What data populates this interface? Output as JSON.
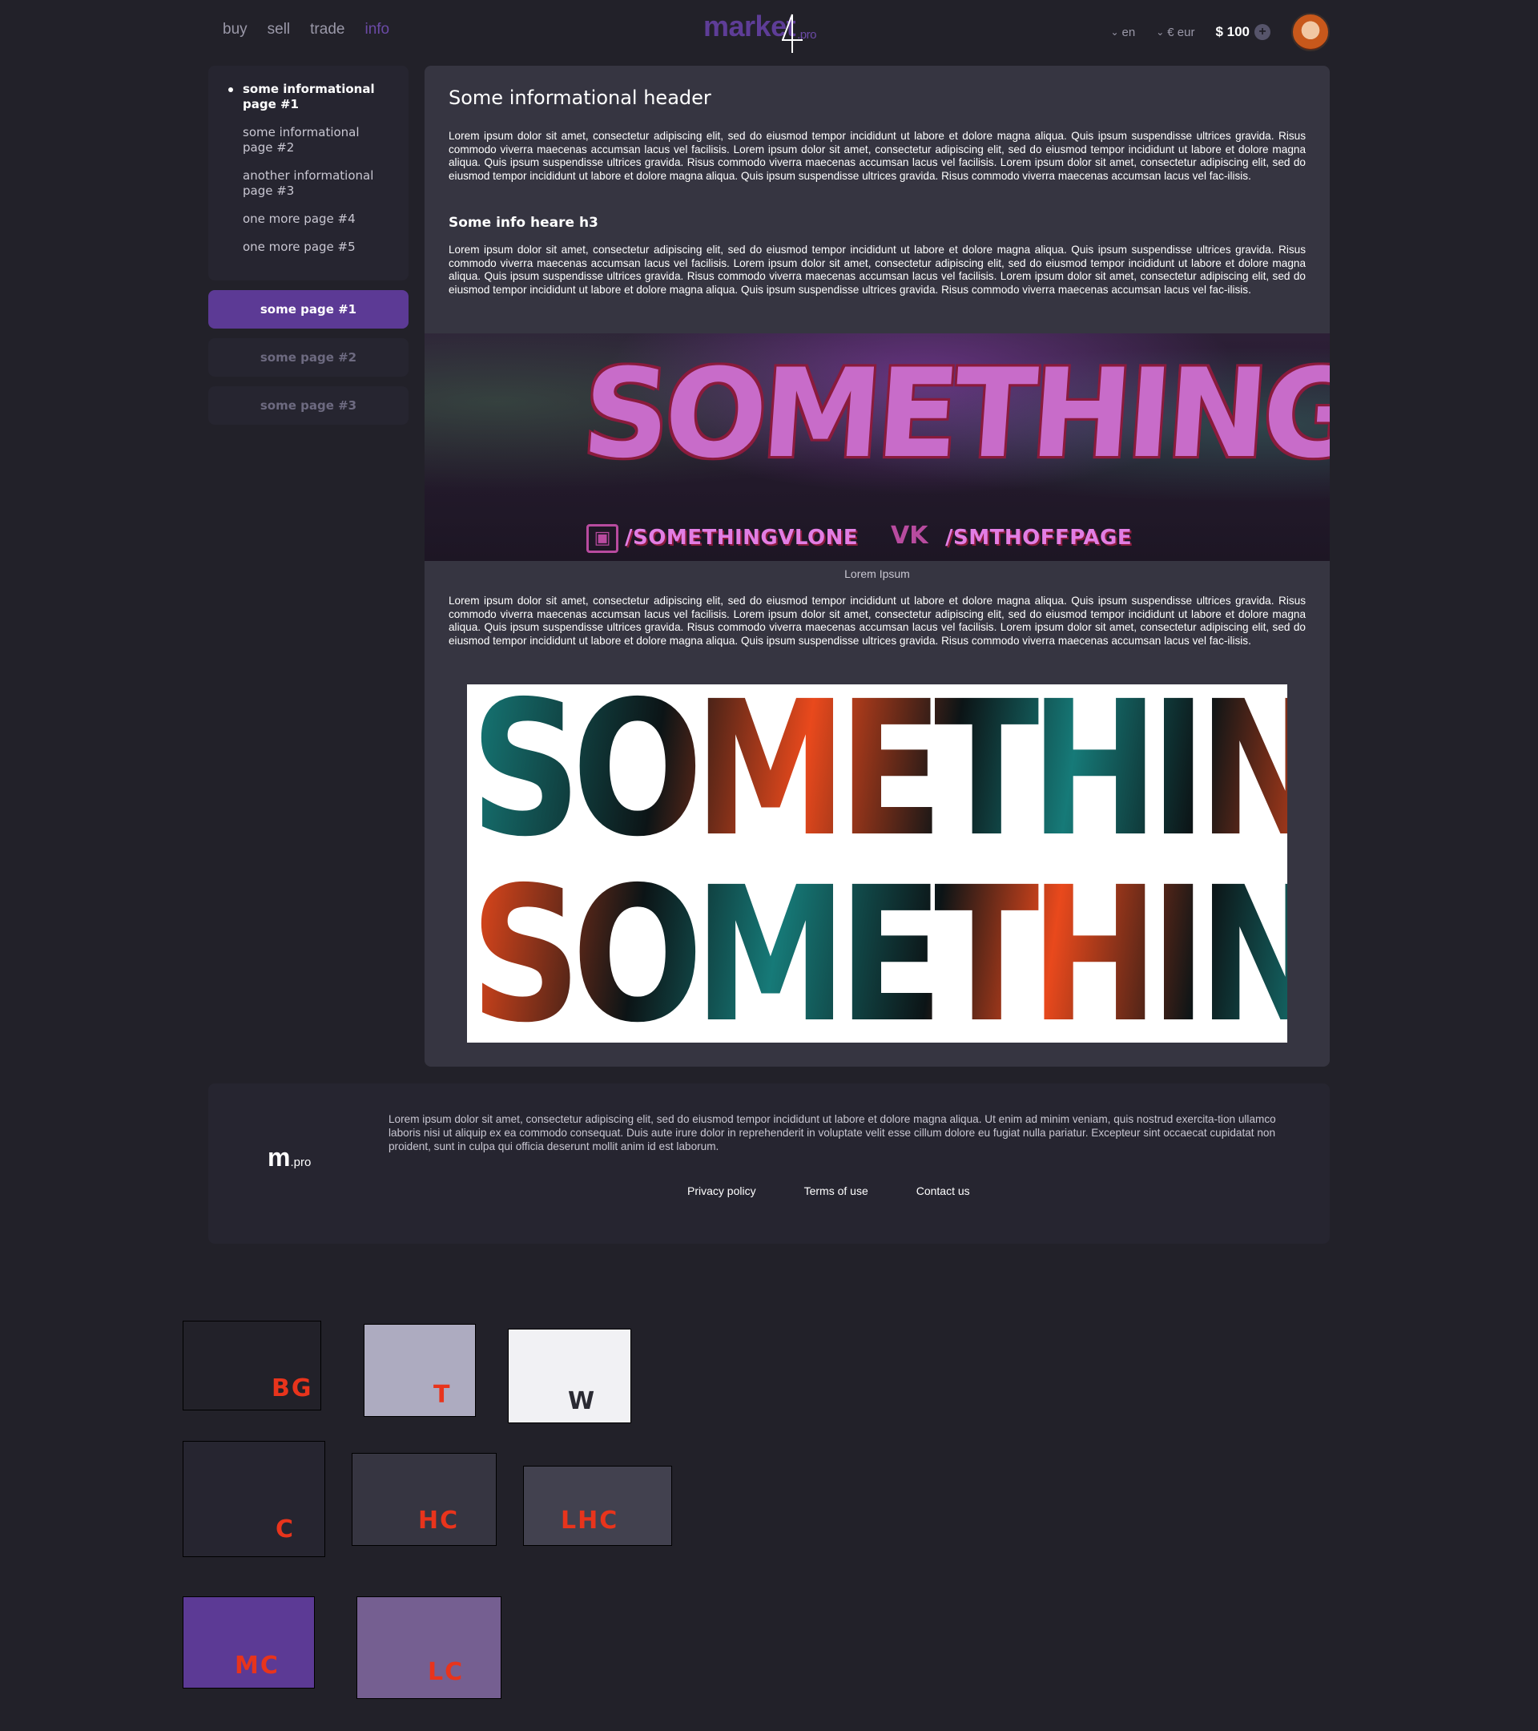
{
  "nav": {
    "items": [
      "buy",
      "sell",
      "trade",
      "info"
    ],
    "active": "info"
  },
  "logo": {
    "text": "market",
    "suffix": ".pro"
  },
  "header": {
    "lang": "en",
    "currency": "€ eur",
    "balance": "$ 100"
  },
  "sidebar": {
    "pages": [
      "some informational page #1",
      "some informational page #2",
      "another  informational page #3",
      "one more page #4",
      "one more page #5"
    ],
    "buttons": [
      "some page #1",
      "some page #2",
      "some page #3"
    ]
  },
  "main": {
    "title": "Some informational header",
    "subtitle": "Some info heare h3",
    "paragraph": "Lorem ipsum dolor sit amet, consectetur adipiscing elit, sed do eiusmod tempor incididunt ut labore et dolore magna aliqua. Quis ipsum suspendisse ultrices gravida. Risus commodo viverra maecenas accumsan lacus vel facilisis. Lorem ipsum dolor sit amet, consectetur adipiscing elit, sed do eiusmod tempor incididunt ut labore et dolore magna aliqua. Quis ipsum suspendisse ultrices gravida. Risus commodo viverra maecenas accumsan lacus vel facilisis. Lorem ipsum dolor sit amet, consectetur adipiscing elit, sed do eiusmod tempor incididunt ut labore et dolore magna aliqua. Quis ipsum suspendisse ultrices gravida. Risus commodo viverra maecenas accumsan lacus vel fac-ilisis.",
    "banner": {
      "title": "SOMETHING",
      "twitch": "/SOMETHINGVLONE",
      "vk": "/SMTHOFFPAGE"
    },
    "caption": "Lorem Ipsum",
    "image2": {
      "line1": "SOMETHING",
      "line2": "SOMETHING"
    }
  },
  "footer": {
    "logo": "m",
    "logo_suffix": ".pro",
    "text": "Lorem ipsum dolor sit amet, consectetur adipiscing elit, sed do eiusmod tempor incididunt ut labore et dolore magna aliqua. Ut enim ad minim veniam, quis nostrud exercita-tion ullamco laboris nisi ut aliquip ex ea commodo consequat. Duis aute irure dolor in reprehenderit in voluptate velit esse cillum dolore eu fugiat nulla pariatur. Excepteur sint occaecat cupidatat non proident, sunt in culpa qui officia deserunt mollit anim id est laborum.",
    "links": [
      "Privacy policy",
      "Terms of use",
      "Contact us"
    ]
  },
  "palette": [
    {
      "label": "BG",
      "color": "#222129",
      "ink": "#e8341c"
    },
    {
      "label": "T",
      "color": "#adabc0",
      "ink": "#e8341c"
    },
    {
      "label": "W",
      "color": "#f1f1f4",
      "ink": "#2a2a33"
    },
    {
      "label": "C",
      "color": "#262530",
      "ink": "#e8341c"
    },
    {
      "label": "HC",
      "color": "#363541",
      "ink": "#e8341c"
    },
    {
      "label": "LHC",
      "color": "#42414f",
      "ink": "#e8341c"
    },
    {
      "label": "MC",
      "color": "#5c3a95",
      "ink": "#e8341c"
    },
    {
      "label": "LC",
      "color": "#755f91",
      "ink": "#e8341c"
    }
  ]
}
